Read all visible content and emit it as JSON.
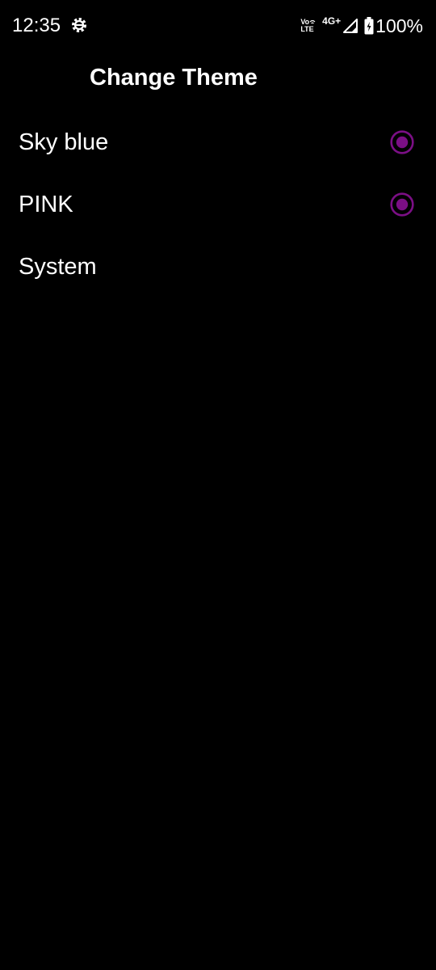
{
  "status_bar": {
    "time": "12:35",
    "volte_top": "Vo",
    "volte_bottom": "LTE",
    "network_type": "4G+",
    "battery": "100%"
  },
  "app_bar": {
    "title": "Change Theme"
  },
  "options": [
    {
      "label": "Sky blue",
      "radio_visible": true
    },
    {
      "label": "PINK",
      "radio_visible": true
    },
    {
      "label": "System",
      "radio_visible": false
    }
  ],
  "colors": {
    "background": "#000000",
    "text": "#ffffff",
    "accent": "#7b0f85"
  }
}
